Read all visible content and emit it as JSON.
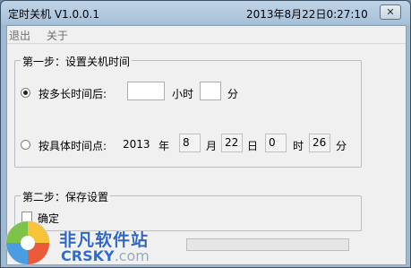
{
  "window": {
    "title": "定时关机 V1.0.0.1",
    "clock": "2013年8月22日0:27:10",
    "close_glyph": "✕"
  },
  "menu": {
    "items": [
      "退出",
      "关于"
    ]
  },
  "step1": {
    "legend": "第一步：设置关机时间",
    "option_duration": {
      "label": "按多长时间后:",
      "selected": true,
      "hours_value": "",
      "hours_unit": "小时",
      "minutes_value": "",
      "minutes_unit": "分"
    },
    "option_specific": {
      "label": "按具体时间点:",
      "selected": false,
      "year_value": "2013",
      "year_unit": "年",
      "month_value": "8",
      "month_unit": "月",
      "day_value": "22",
      "day_unit": "日",
      "hour_value": "0",
      "hour_unit": "时",
      "minute_value": "26",
      "minute_unit": "分"
    }
  },
  "step2": {
    "legend": "第二步：保存设置",
    "confirm_label": "确定",
    "confirm_checked": false
  },
  "watermark": {
    "text": "非凡软件站",
    "sub": "CRSKY",
    "sub_suffix": ".com"
  }
}
